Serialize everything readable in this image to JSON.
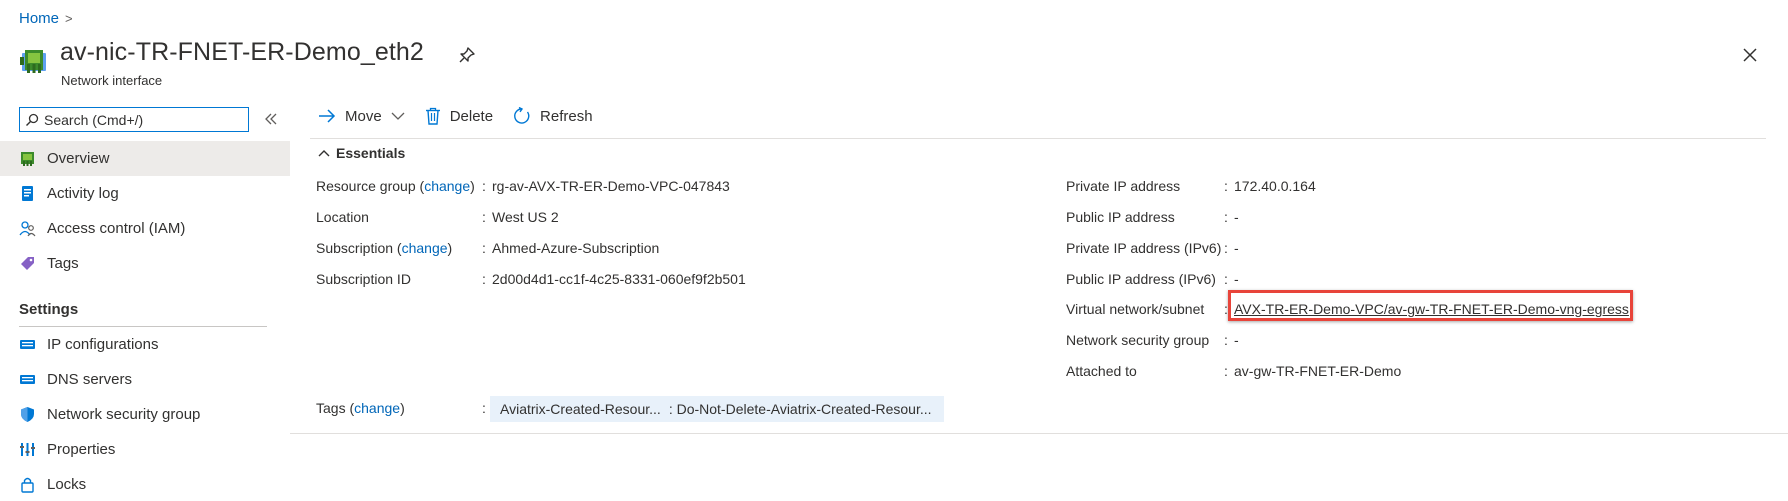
{
  "breadcrumb": {
    "home": "Home",
    "chevron": ">"
  },
  "header": {
    "title": "av-nic-TR-FNET-ER-Demo_eth2",
    "subtitle": "Network interface"
  },
  "search": {
    "placeholder": "Search (Cmd+/)"
  },
  "sidebar": {
    "items": [
      {
        "label": "Overview",
        "icon": "nic-icon",
        "active": true
      },
      {
        "label": "Activity log",
        "icon": "activity-log-icon"
      },
      {
        "label": "Access control (IAM)",
        "icon": "iam-icon"
      },
      {
        "label": "Tags",
        "icon": "tag-icon"
      }
    ],
    "settings_header": "Settings",
    "settings_items": [
      {
        "label": "IP configurations",
        "icon": "ip-config-icon"
      },
      {
        "label": "DNS servers",
        "icon": "dns-icon"
      },
      {
        "label": "Network security group",
        "icon": "shield-icon"
      },
      {
        "label": "Properties",
        "icon": "properties-icon"
      },
      {
        "label": "Locks",
        "icon": "lock-icon"
      }
    ]
  },
  "toolbar": {
    "move": "Move",
    "delete": "Delete",
    "refresh": "Refresh"
  },
  "essentials": {
    "header": "Essentials",
    "left": [
      {
        "label": "Resource group",
        "change": "change",
        "value": "rg-av-AVX-TR-ER-Demo-VPC-047843",
        "link": true
      },
      {
        "label": "Location",
        "value": "West US 2"
      },
      {
        "label": "Subscription",
        "change": "change",
        "value": "Ahmed-Azure-Subscription",
        "link": true
      },
      {
        "label": "Subscription ID",
        "value": "2d00d4d1-cc1f-4c25-8331-060ef9f2b501"
      }
    ],
    "right": [
      {
        "label": "Private IP address",
        "value": "172.40.0.164"
      },
      {
        "label": "Public IP address",
        "value": "-"
      },
      {
        "label": "Private IP address (IPv6)",
        "value": "-"
      },
      {
        "label": "Public IP address (IPv6)",
        "value": "-"
      },
      {
        "label": "Virtual network/subnet",
        "value": "AVX-TR-ER-Demo-VPC/av-gw-TR-FNET-ER-Demo-vng-egress",
        "link": true,
        "highlighted": true
      },
      {
        "label": "Network security group",
        "value": "-"
      },
      {
        "label": "Attached to",
        "value": "av-gw-TR-FNET-ER-Demo",
        "link": true
      }
    ],
    "tags": {
      "label": "Tags",
      "change": "change",
      "key": "Aviatrix-Created-Resour...",
      "value": ": Do-Not-Delete-Aviatrix-Created-Resour..."
    }
  },
  "colors": {
    "link": "#0066b8",
    "highlight": "#e8443a",
    "accent": "#0078d4"
  }
}
